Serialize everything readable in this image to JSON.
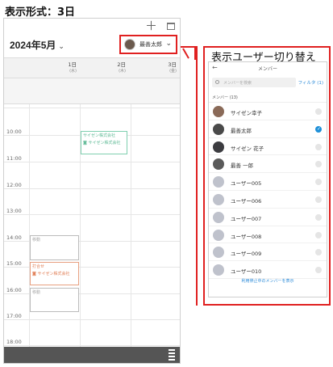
{
  "caption": "表示形式：3日",
  "calendar": {
    "month": "2024年5月",
    "current_user": "最善太郎",
    "days": [
      {
        "num": "1日",
        "weekday": "(水)"
      },
      {
        "num": "2日",
        "weekday": "(木)"
      },
      {
        "num": "3日",
        "weekday": "(金)"
      }
    ],
    "hours": [
      "10:00",
      "11:00",
      "12:00",
      "13:00",
      "14:00",
      "15:00",
      "16:00",
      "17:00",
      "18:00"
    ],
    "events": {
      "e1_title": "サイゼン株式会社",
      "e1_sub": "サイゼン株式会社",
      "e2_title": "移動",
      "e3_title": "打合せ",
      "e3_sub": "サイゼン株式会社",
      "e4_title": "移動"
    }
  },
  "panel": {
    "title": "表示ユーザー切り替え",
    "tab": "メンバー",
    "search_placeholder": "メンバーを検索",
    "filter": "フィルタ (1)",
    "member_count": "メンバー (13)",
    "members": [
      "サイゼン幸子",
      "最善太郎",
      "サイゼン 花子",
      "最善 一郎",
      "ユーザー005",
      "ユーザー006",
      "ユーザー007",
      "ユーザー008",
      "ユーザー009",
      "ユーザー010"
    ],
    "show_stopped": "利用停止中のメンバーを表示"
  },
  "colors": {
    "accent": "#e02020",
    "link": "#2a8ad8",
    "event_green": "#5bb893",
    "event_orange": "#e07a50"
  }
}
